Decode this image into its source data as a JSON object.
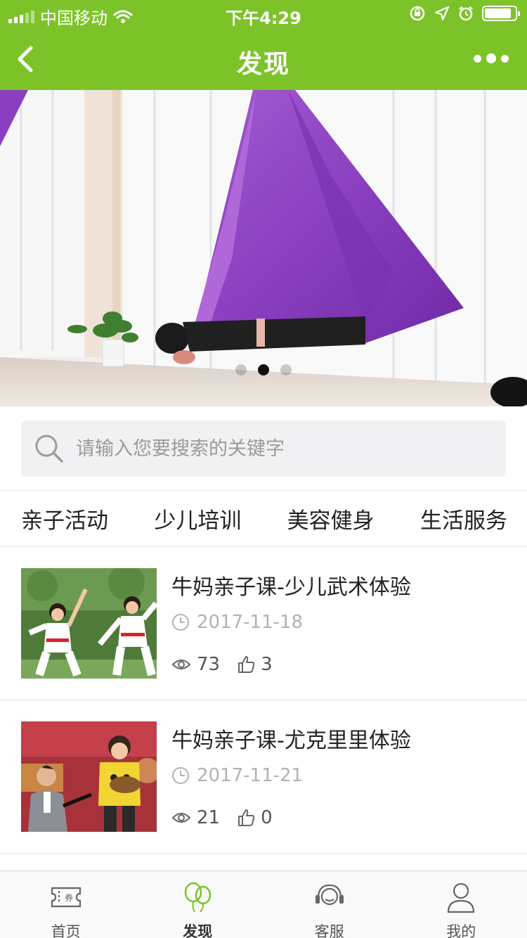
{
  "status": {
    "carrier": "中国移动",
    "time": "下午4:29"
  },
  "nav": {
    "title": "发现"
  },
  "banner": {
    "slide_count": 3,
    "active_slide": 2
  },
  "search": {
    "placeholder": "请输入您要搜索的关键字",
    "value": ""
  },
  "categories": [
    "亲子活动",
    "少儿培训",
    "美容健身",
    "生活服务"
  ],
  "articles": [
    {
      "title": "牛妈亲子课-少儿武术体验",
      "date": "2017-11-18",
      "views": "73",
      "likes": "3"
    },
    {
      "title": "牛妈亲子课-尤克里里体验",
      "date": "2017-11-21",
      "views": "21",
      "likes": "0"
    }
  ],
  "tabs": [
    {
      "label": "首页",
      "icon": "ticket-icon"
    },
    {
      "label": "发现",
      "icon": "balloons-icon"
    },
    {
      "label": "客服",
      "icon": "headset-icon"
    },
    {
      "label": "我的",
      "icon": "user-icon"
    }
  ],
  "colors": {
    "brand_green": "#7cc32a",
    "active_dot": "#111111",
    "tab_active_icon": "#7cc32a"
  }
}
